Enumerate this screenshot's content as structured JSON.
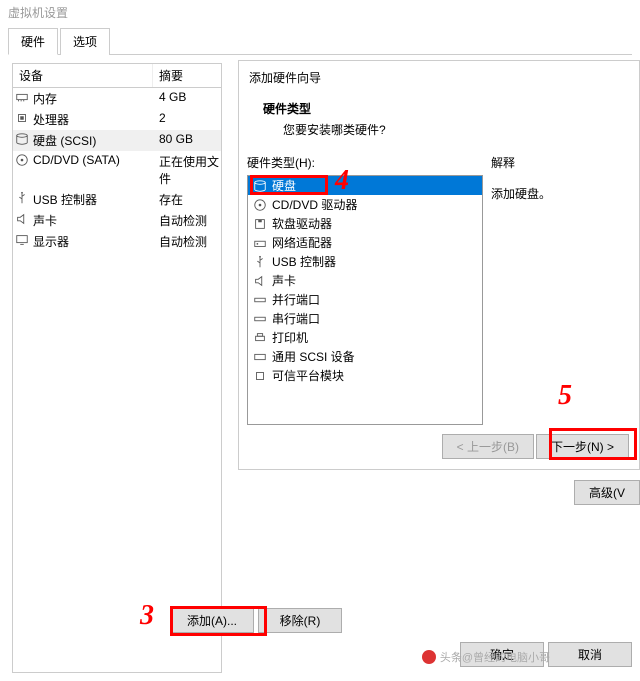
{
  "window": {
    "title": "虚拟机设置"
  },
  "tabs": {
    "hardware": "硬件",
    "options": "选项"
  },
  "devicePanel": {
    "colDevice": "设备",
    "colSummary": "摘要",
    "rows": [
      {
        "name": "内存",
        "summary": "4 GB",
        "icon": "memory"
      },
      {
        "name": "处理器",
        "summary": "2",
        "icon": "cpu"
      },
      {
        "name": "硬盘 (SCSI)",
        "summary": "80 GB",
        "icon": "disk",
        "selected": true
      },
      {
        "name": "CD/DVD (SATA)",
        "summary": "正在使用文件",
        "icon": "cd"
      },
      {
        "name": "USB 控制器",
        "summary": "存在",
        "icon": "usb"
      },
      {
        "name": "声卡",
        "summary": "自动检测",
        "icon": "sound"
      },
      {
        "name": "显示器",
        "summary": "自动检测",
        "icon": "display"
      }
    ]
  },
  "buttons": {
    "add": "添加(A)...",
    "remove": "移除(R)",
    "ok": "确定",
    "cancel": "取消",
    "advanced": "高级(V"
  },
  "wizard": {
    "title": "添加硬件向导",
    "heading": "硬件类型",
    "subheading": "您要安装哪类硬件?",
    "listLabel": "硬件类型(H):",
    "explainLabel": "解释",
    "explainText": "添加硬盘。",
    "items": [
      {
        "label": "硬盘",
        "icon": "disk",
        "selected": true
      },
      {
        "label": "CD/DVD 驱动器",
        "icon": "cd"
      },
      {
        "label": "软盘驱动器",
        "icon": "floppy"
      },
      {
        "label": "网络适配器",
        "icon": "network"
      },
      {
        "label": "USB 控制器",
        "icon": "usb"
      },
      {
        "label": "声卡",
        "icon": "sound"
      },
      {
        "label": "并行端口",
        "icon": "port"
      },
      {
        "label": "串行端口",
        "icon": "port"
      },
      {
        "label": "打印机",
        "icon": "printer"
      },
      {
        "label": "通用 SCSI 设备",
        "icon": "scsi"
      },
      {
        "label": "可信平台模块",
        "icon": "tpm"
      }
    ],
    "back": "< 上一步(B)",
    "next": "下一步(N) >"
  },
  "annotations": {
    "a3": "3",
    "a4": "4",
    "a5": "5"
  },
  "watermark": "头条@曾经的电脑小哥"
}
